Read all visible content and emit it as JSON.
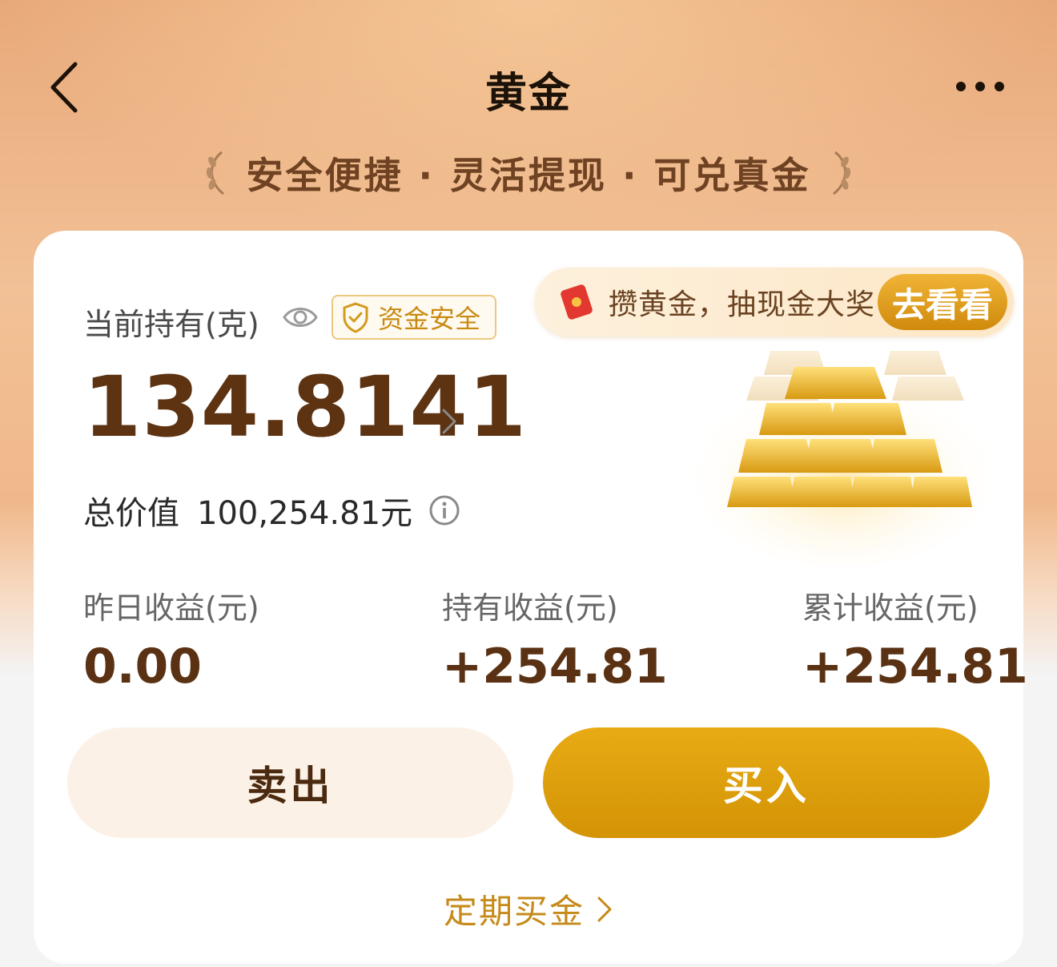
{
  "header": {
    "title": "黄金",
    "back_icon": "chevron-left-icon",
    "more_icon": "more-dots-icon"
  },
  "slogan": "安全便捷 · 灵活提现 · 可兑真金",
  "card": {
    "holding_label": "当前持有(克)",
    "safe_badge_label": "资金安全",
    "grams_value": "134.8141",
    "total_label": "总价值",
    "total_value": "100,254.81元",
    "promo": {
      "text": "攒黄金，抽现金大奖",
      "button_label": "去看看"
    },
    "stats": [
      {
        "label": "昨日收益(元)",
        "value": "0.00"
      },
      {
        "label": "持有收益(元)",
        "value": "+254.81"
      },
      {
        "label": "累计收益(元)",
        "value": "+254.81"
      }
    ],
    "sell_label": "卖出",
    "buy_label": "买入",
    "regular_link_label": "定期买金"
  },
  "colors": {
    "accent_gold": "#d39305",
    "dark_brown": "#5a3213",
    "link_gold": "#c58a1a"
  }
}
